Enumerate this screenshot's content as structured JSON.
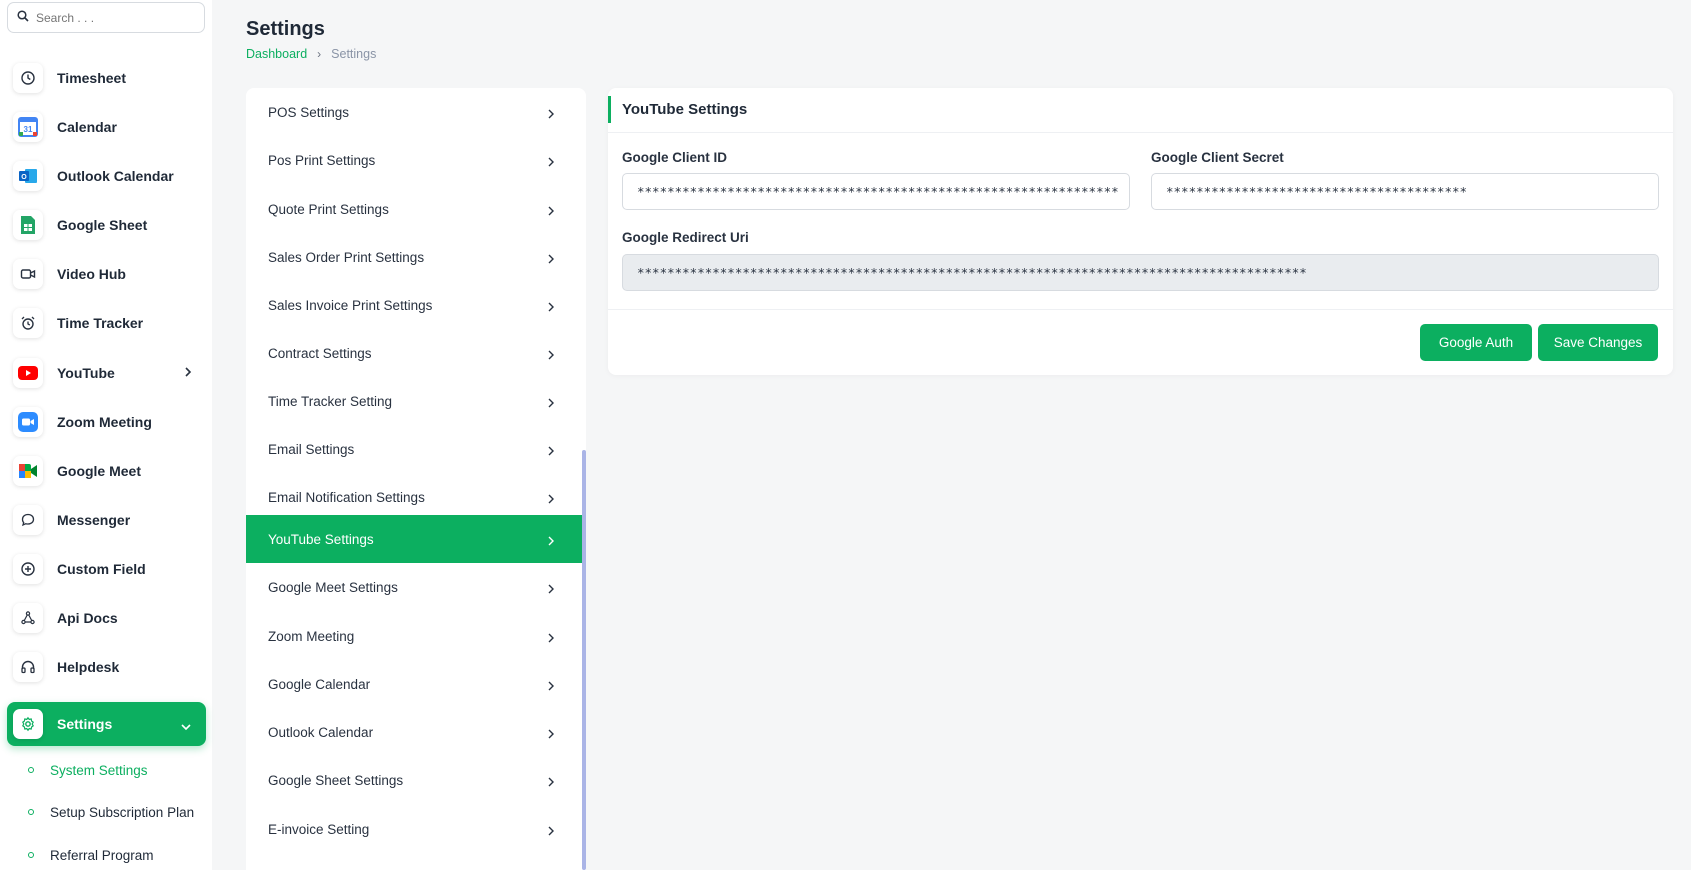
{
  "search": {
    "placeholder": "Search . . ."
  },
  "sidebar": {
    "items": [
      {
        "label": "Timesheet",
        "icon": "clock-icon"
      },
      {
        "label": "Calendar",
        "icon": "calendar-icon"
      },
      {
        "label": "Outlook Calendar",
        "icon": "outlook-icon"
      },
      {
        "label": "Google Sheet",
        "icon": "google-sheet-icon"
      },
      {
        "label": "Video Hub",
        "icon": "video-icon"
      },
      {
        "label": "Time Tracker",
        "icon": "alarm-clock-icon"
      },
      {
        "label": "YouTube",
        "icon": "youtube-icon"
      },
      {
        "label": "Zoom Meeting",
        "icon": "zoom-icon"
      },
      {
        "label": "Google Meet",
        "icon": "google-meet-icon"
      },
      {
        "label": "Messenger",
        "icon": "message-icon"
      },
      {
        "label": "Custom Field",
        "icon": "plus-circle-icon"
      },
      {
        "label": "Api Docs",
        "icon": "api-icon"
      },
      {
        "label": "Helpdesk",
        "icon": "headset-icon"
      },
      {
        "label": "Settings",
        "icon": "gear-icon"
      }
    ],
    "sub_items": [
      {
        "label": "System Settings"
      },
      {
        "label": "Setup Subscription Plan"
      },
      {
        "label": "Referral Program"
      }
    ]
  },
  "header": {
    "title": "Settings",
    "breadcrumb": {
      "home": "Dashboard",
      "current": "Settings"
    }
  },
  "settings_list": [
    "POS Settings",
    "Pos Print Settings",
    "Quote Print Settings",
    "Sales Order Print Settings",
    "Sales Invoice Print Settings",
    "Contract Settings",
    "Time Tracker Setting",
    "Email Settings",
    "Email Notification Settings",
    "YouTube Settings",
    "Google Meet Settings",
    "Zoom Meeting",
    "Google Calendar",
    "Outlook Calendar",
    "Google Sheet Settings",
    "E-invoice Setting"
  ],
  "card": {
    "title": "YouTube Settings",
    "client_id_label": "Google Client ID",
    "client_id_value": "****************************************************************",
    "client_secret_label": "Google Client Secret",
    "client_secret_value": "****************************************",
    "redirect_label": "Google Redirect Uri",
    "redirect_value": "*****************************************************************************************",
    "auth_button": "Google Auth",
    "save_button": "Save Changes"
  },
  "colors": {
    "accent": "#0caf60",
    "scrollbar": "#aab4e6"
  }
}
